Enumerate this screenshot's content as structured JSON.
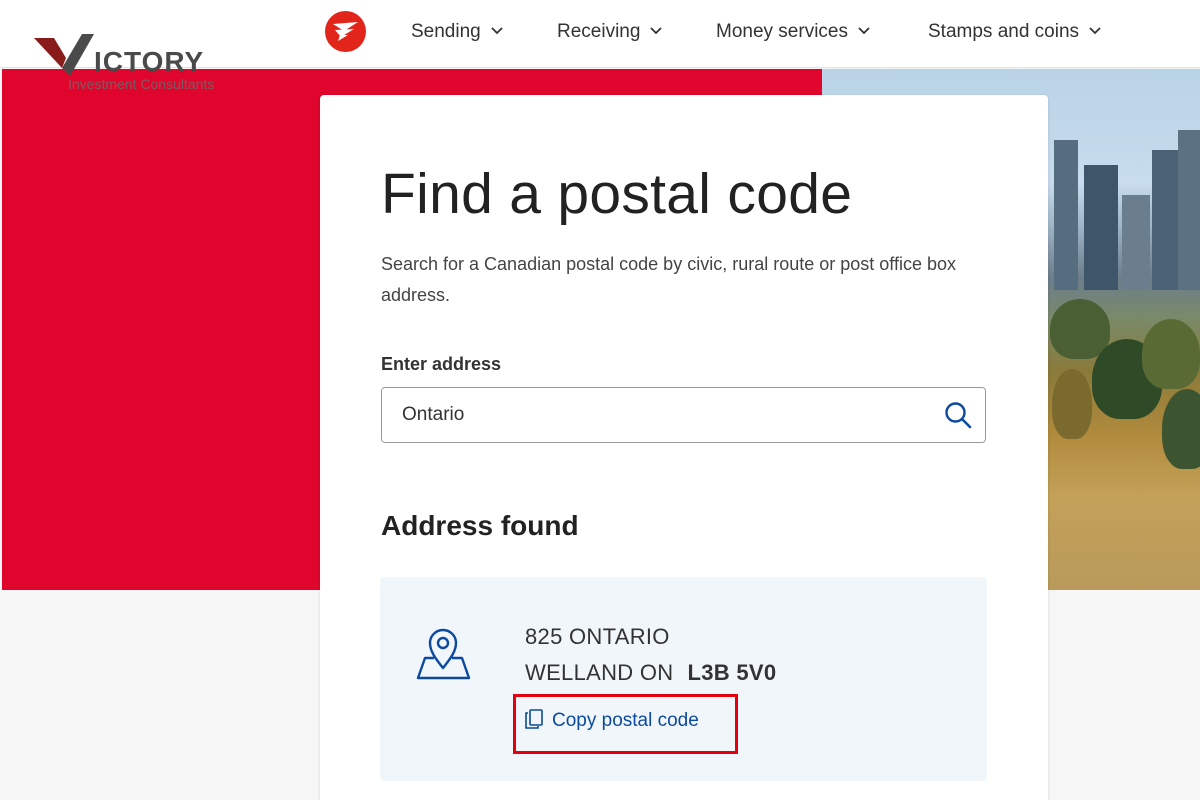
{
  "header": {
    "logo": "canada-post-logo",
    "nav": [
      {
        "label": "Sending"
      },
      {
        "label": "Receiving"
      },
      {
        "label": "Money services"
      },
      {
        "label": "Stamps and coins"
      }
    ]
  },
  "watermark": {
    "brand": "ICTORY",
    "subtitle": "Investment Consultants"
  },
  "colors": {
    "brand_red": "#e0052d",
    "link_blue": "#0b4a9e",
    "highlight_red": "#e3000f",
    "result_bg": "#f1f6fb"
  },
  "main": {
    "title": "Find a postal code",
    "description": "Search for a Canadian postal code by civic, rural route or post office box address.",
    "address_label": "Enter address",
    "search": {
      "value": "Ontario",
      "icon": "search-icon"
    },
    "result_heading": "Address found",
    "result": {
      "icon": "map-pin-icon",
      "line1": "825 ONTARIO",
      "city_prov": "WELLAND ON",
      "postal_code": "L3B 5V0",
      "copy_label": "Copy postal code",
      "copy_icon": "copy-icon"
    }
  }
}
